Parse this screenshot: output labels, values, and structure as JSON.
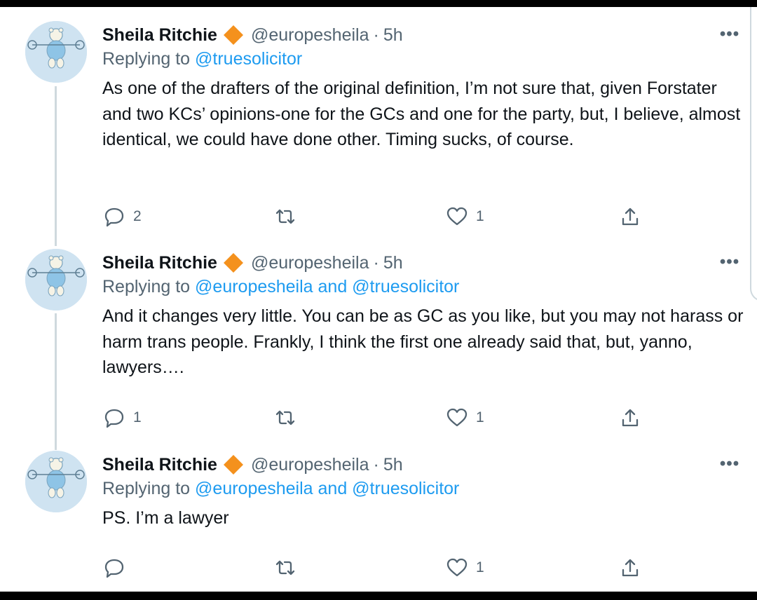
{
  "tweets": [
    {
      "name": "Sheila Ritchie",
      "handle": "@europesheila",
      "separator": "·",
      "time": "5h",
      "reply_prefix": "Replying to",
      "reply_to": "@truesolicitor",
      "body": "As one of the drafters of the original definition, I’m not sure that, given Forstater and two KCs’ opinions-one for the GCs and one for the party, but, I believe, almost identical, we could have done other. Timing sucks, of course.",
      "replies": "2",
      "retweets": "",
      "likes": "1"
    },
    {
      "name": "Sheila Ritchie",
      "handle": "@europesheila",
      "separator": "·",
      "time": "5h",
      "reply_prefix": "Replying to",
      "reply_to": "@europesheila and @truesolicitor",
      "body": "And it changes very little. You can be as GC as you like, but you may not harass or harm trans people. Frankly, I think the first one already said that, but, yanno, lawyers….",
      "replies": "1",
      "retweets": "",
      "likes": "1"
    },
    {
      "name": "Sheila Ritchie",
      "handle": "@europesheila",
      "separator": "·",
      "time": "5h",
      "reply_prefix": "Replying to",
      "reply_to": "@europesheila and @truesolicitor",
      "body": "PS. I’m a lawyer",
      "replies": "",
      "retweets": "",
      "likes": "1"
    }
  ],
  "icons": {
    "verified": "orange-diamond-badge-icon",
    "more": "more-horizontal-icon",
    "reply": "reply-icon",
    "retweet": "retweet-icon",
    "like": "heart-icon",
    "share": "share-icon"
  },
  "colors": {
    "accent": "#1d9bf0",
    "badge": "#f4911d",
    "muted": "#536471",
    "text": "#0f1419",
    "avatar_bg": "#cfe3f1"
  }
}
